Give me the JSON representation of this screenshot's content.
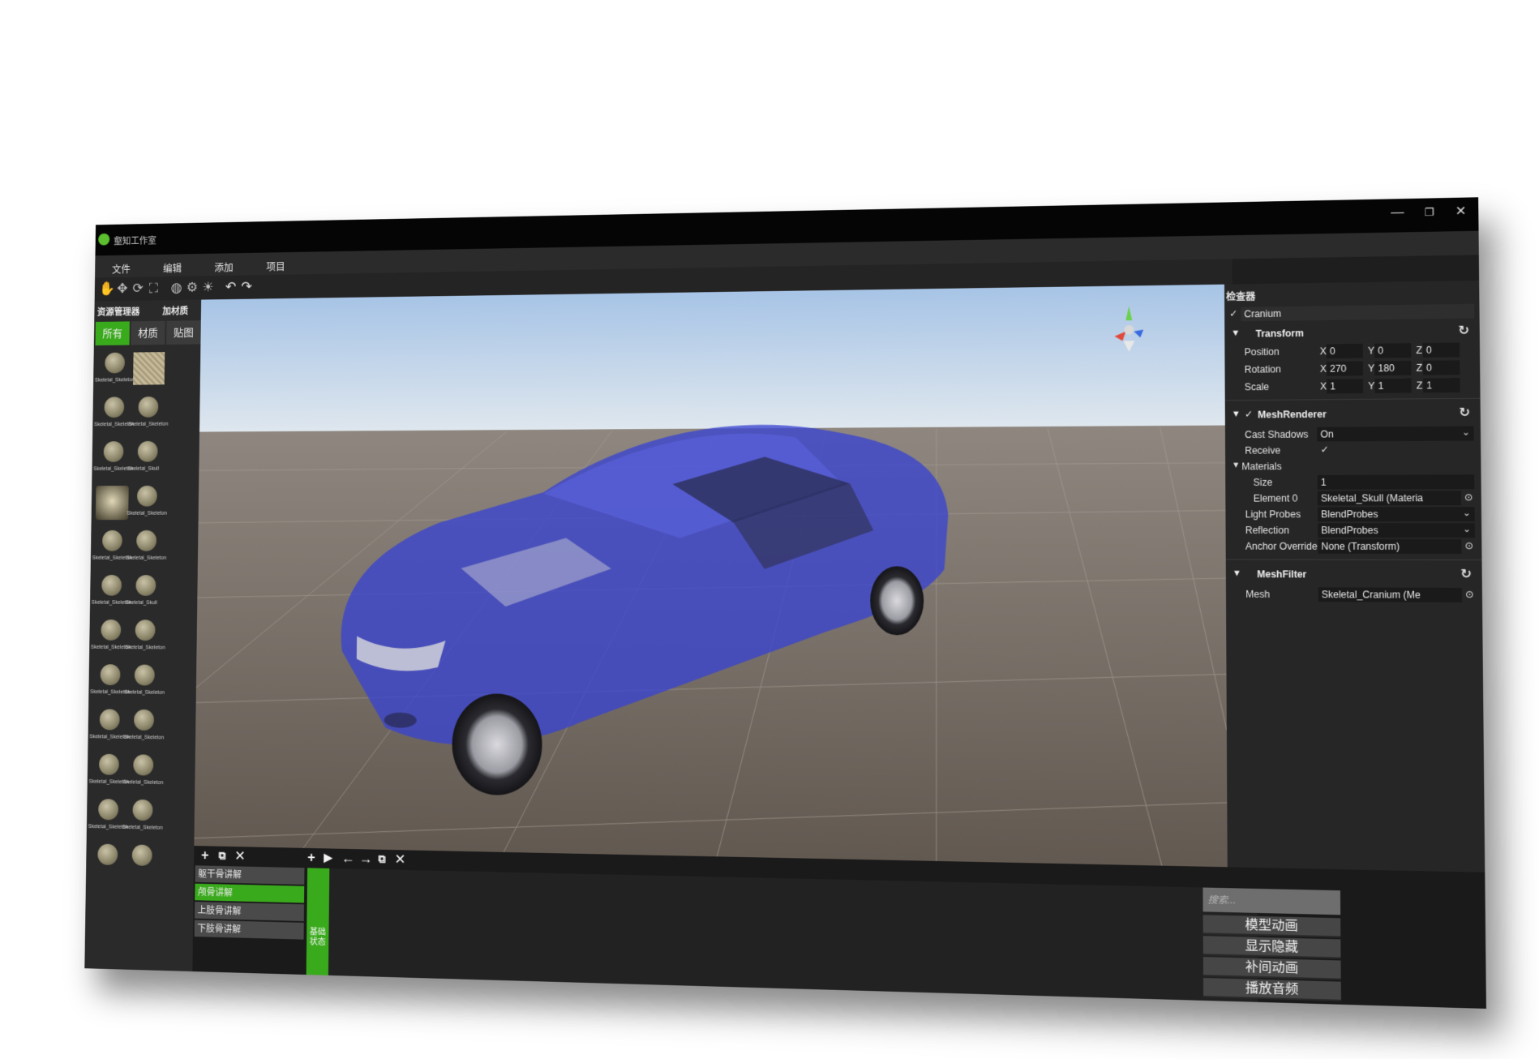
{
  "window": {
    "title": "壑知工作室",
    "minimize": "—",
    "restore": "❐",
    "close": "✕"
  },
  "menu": [
    "文件",
    "编辑",
    "添加",
    "项目"
  ],
  "asset_panel": {
    "title": "资源管理器",
    "add_material": "加材质",
    "tabs": [
      "所有",
      "材质",
      "贴图"
    ],
    "items": [
      {
        "label": "Skeletal_Skeleton",
        "kind": "sphere"
      },
      {
        "label": "",
        "kind": "texture"
      },
      {
        "label": "Skeletal_Skeleton",
        "kind": "sphere"
      },
      {
        "label": "Skeletal_Skeleton",
        "kind": "sphere"
      },
      {
        "label": "Skeletal_Skeleton",
        "kind": "sphere"
      },
      {
        "label": "Skeletal_Skull",
        "kind": "sphere"
      },
      {
        "label": "",
        "kind": "skull"
      },
      {
        "label": "Skeletal_Skeleton",
        "kind": "sphere"
      },
      {
        "label": "Skeletal_Skeleton",
        "kind": "sphere"
      },
      {
        "label": "Skeletal_Skeleton",
        "kind": "sphere"
      },
      {
        "label": "Skeletal_Skeleton",
        "kind": "sphere"
      },
      {
        "label": "Skeletal_Skull",
        "kind": "sphere"
      },
      {
        "label": "Skeletal_Skeleton",
        "kind": "sphere"
      },
      {
        "label": "Skeletal_Skeleton",
        "kind": "sphere"
      },
      {
        "label": "Skeletal_Skeleton",
        "kind": "sphere"
      },
      {
        "label": "Skeletal_Skeleton",
        "kind": "sphere"
      },
      {
        "label": "Skeletal_Skeleton",
        "kind": "sphere"
      },
      {
        "label": "Skeletal_Skeleton",
        "kind": "sphere"
      },
      {
        "label": "Skeletal_Skeleton",
        "kind": "sphere"
      },
      {
        "label": "Skeletal_Skeleton",
        "kind": "sphere"
      },
      {
        "label": "Skeletal_Skeleton",
        "kind": "sphere"
      },
      {
        "label": "Skeletal_Skeleton",
        "kind": "sphere"
      },
      {
        "label": "",
        "kind": "sphere"
      },
      {
        "label": "",
        "kind": "sphere"
      }
    ]
  },
  "inspector": {
    "title": "检查器",
    "object_name": "Cranium",
    "transform": {
      "title": "Transform",
      "position": {
        "label": "Position",
        "x": "0",
        "y": "0",
        "z": "0"
      },
      "rotation": {
        "label": "Rotation",
        "x": "270",
        "y": "180",
        "z": "0"
      },
      "scale": {
        "label": "Scale",
        "x": "1",
        "y": "1",
        "z": "1"
      },
      "axis_x": "X",
      "axis_y": "Y",
      "axis_z": "Z"
    },
    "mesh_renderer": {
      "title": "MeshRenderer",
      "cast_shadows": {
        "label": "Cast Shadows",
        "value": "On"
      },
      "receive": {
        "label": "Receive"
      },
      "materials": {
        "label": "Materials"
      },
      "size": {
        "label": "Size",
        "value": "1"
      },
      "element0": {
        "label": "Element 0",
        "value": "Skeletal_Skull (Materia"
      },
      "light_probes": {
        "label": "Light Probes",
        "value": "BlendProbes"
      },
      "reflection": {
        "label": "Reflection",
        "value": "BlendProbes"
      },
      "anchor_override": {
        "label": "Anchor Override",
        "value": "None (Transform)"
      }
    },
    "mesh_filter": {
      "title": "MeshFilter",
      "mesh": {
        "label": "Mesh",
        "value": "Skeletal_Cranium (Me"
      }
    }
  },
  "steps": [
    "躯干骨讲解",
    "颅骨讲解",
    "上肢骨讲解",
    "下肢骨讲解"
  ],
  "active_step": 1,
  "state_label": "基础状态",
  "search": {
    "placeholder": "搜索..."
  },
  "actions": [
    "模型动画",
    "显示隐藏",
    "补间动画",
    "播放音频"
  ],
  "colors": {
    "accent": "#3aaa1d",
    "car_body": "#3a44d0"
  }
}
